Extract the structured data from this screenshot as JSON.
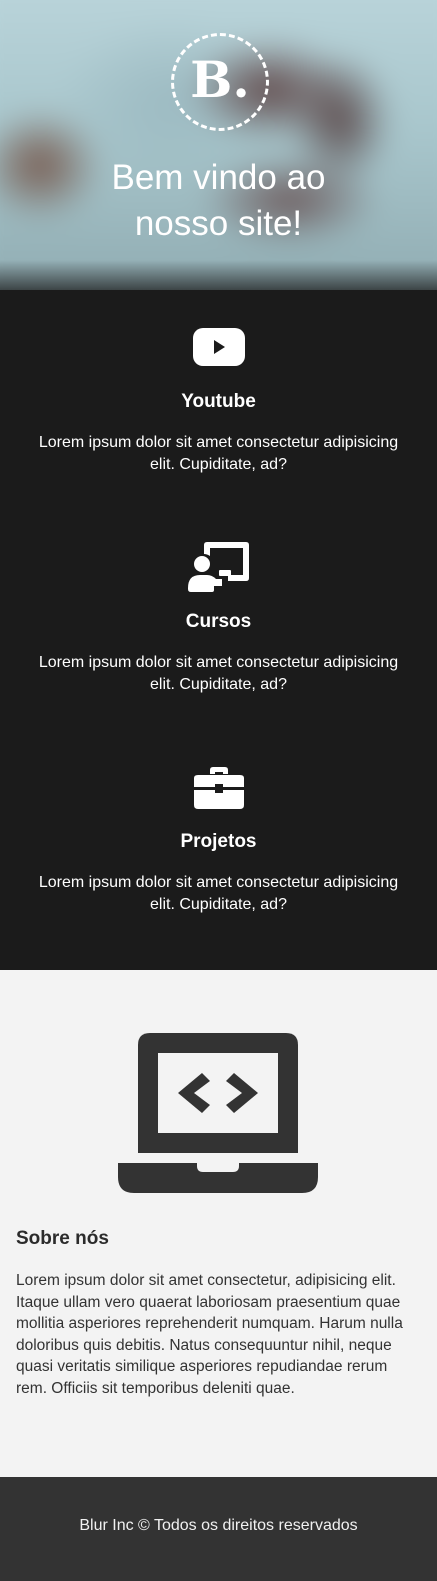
{
  "hero": {
    "logo_text": "B.",
    "title": "Bem vindo ao nosso site!"
  },
  "services": [
    {
      "icon": "youtube-icon",
      "title": "Youtube",
      "text": "Lorem ipsum dolor sit amet consectetur adipisicing elit. Cupiditate, ad?"
    },
    {
      "icon": "teacher-screen-icon",
      "title": "Cursos",
      "text": "Lorem ipsum dolor sit amet consectetur adipisicing elit. Cupiditate, ad?"
    },
    {
      "icon": "briefcase-icon",
      "title": "Projetos",
      "text": "Lorem ipsum dolor sit amet consectetur adipisicing elit. Cupiditate, ad?"
    }
  ],
  "about": {
    "icon": "laptop-code-icon",
    "title": "Sobre nós",
    "text": "Lorem ipsum dolor sit amet consectetur, adipisicing elit. Itaque ullam vero quaerat laboriosam praesentium quae mollitia asperiores reprehenderit numquam. Harum nulla doloribus quis debitis. Natus consequuntur nihil, neque quasi veritatis similique asperiores repudiandae rerum rem. Officiis sit temporibus deleniti quae."
  },
  "footer": {
    "text": "Blur Inc © Todos os direitos reservados"
  },
  "colors": {
    "dark_section": "#1b1b1b",
    "light_section": "#f3f3f3",
    "footer": "#333333",
    "icon_dark": "#333333"
  }
}
